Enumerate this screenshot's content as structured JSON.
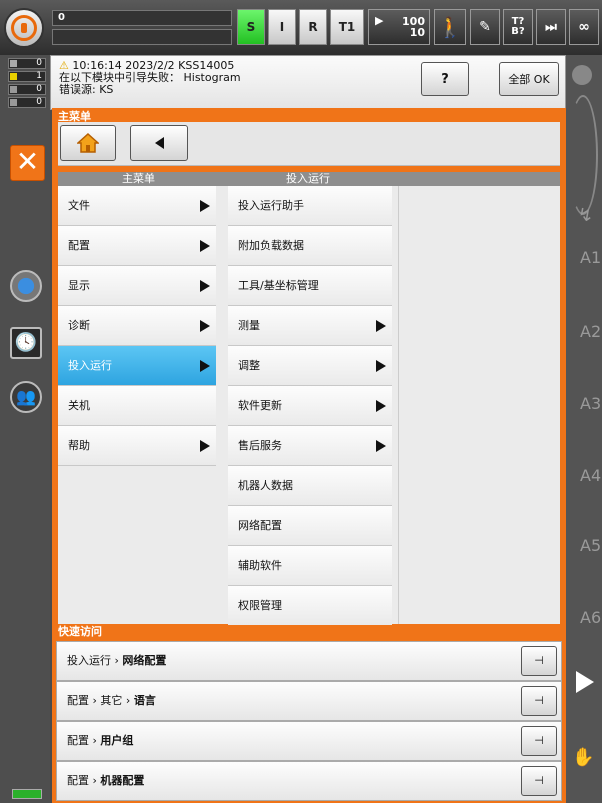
{
  "topbar": {
    "program_name": "0",
    "status_buttons": [
      {
        "label": "S",
        "color": "#44dd44"
      },
      {
        "label": "I"
      },
      {
        "label": "R"
      },
      {
        "label": "T1"
      }
    ],
    "override": {
      "top": "100",
      "bottom": "10"
    },
    "tool_base": {
      "top": "T?",
      "bottom": "B?"
    },
    "infinity": "∞"
  },
  "counters": [
    {
      "icon": "ack-icon",
      "value": "0"
    },
    {
      "icon": "warning-icon",
      "value": "1"
    },
    {
      "icon": "info-icon",
      "value": "0"
    },
    {
      "icon": "dialog-icon",
      "value": "0"
    }
  ],
  "message": {
    "line1": "10:16:14 2023/2/2 KSS14005",
    "line2": "在以下模块中引导失败： Histogram",
    "line3": "错误源: KS",
    "help_label": "?",
    "ok_all_label": "全部 OK"
  },
  "menu": {
    "title": "主菜单",
    "col1_header": "主菜单",
    "col2_header": "投入运行",
    "col1_items": [
      {
        "label": "文件",
        "arrow": true
      },
      {
        "label": "配置",
        "arrow": true
      },
      {
        "label": "显示",
        "arrow": true
      },
      {
        "label": "诊断",
        "arrow": true
      },
      {
        "label": "投入运行",
        "arrow": true,
        "selected": true
      },
      {
        "label": "关机",
        "arrow": false
      },
      {
        "label": "帮助",
        "arrow": true
      }
    ],
    "col2_items": [
      {
        "label": "投入运行助手",
        "arrow": false
      },
      {
        "label": "附加负载数据",
        "arrow": false
      },
      {
        "label": "工具/基坐标管理",
        "arrow": false
      },
      {
        "label": "测量",
        "arrow": true
      },
      {
        "label": "调整",
        "arrow": true
      },
      {
        "label": "软件更新",
        "arrow": true
      },
      {
        "label": "售后服务",
        "arrow": true
      },
      {
        "label": "机器人数据",
        "arrow": false
      },
      {
        "label": "网络配置",
        "arrow": false
      },
      {
        "label": "辅助软件",
        "arrow": false
      },
      {
        "label": "权限管理",
        "arrow": false
      }
    ]
  },
  "quick_access": {
    "title": "快速访问",
    "rows": [
      {
        "part1": "投入运行",
        "part2": "网络配置"
      },
      {
        "part1": "配置",
        "part2": "其它",
        "part3": "语言"
      },
      {
        "part1": "配置",
        "part2": "用户组"
      },
      {
        "part1": "配置",
        "part2": "机器配置"
      }
    ]
  },
  "axes": [
    "A1",
    "A2",
    "A3",
    "A4",
    "A5",
    "A6"
  ],
  "colors": {
    "accent": "#f07418",
    "selected": "#2ea4e0",
    "status_green": "#44dd44"
  }
}
